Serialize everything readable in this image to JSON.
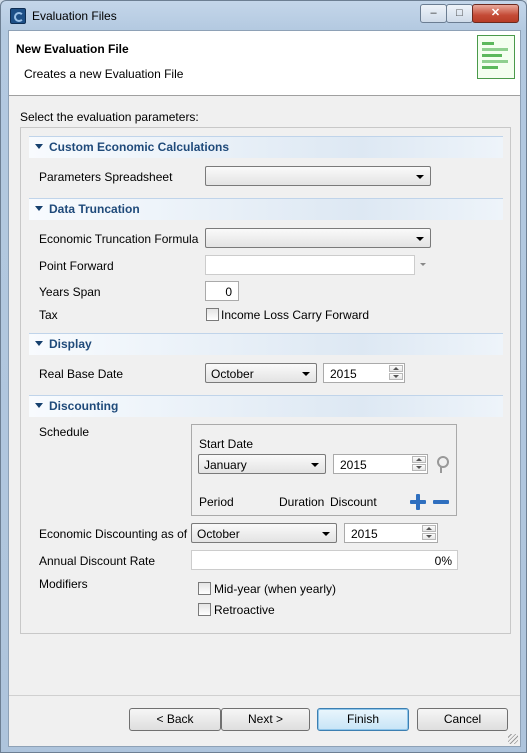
{
  "window": {
    "title": "Evaluation Files",
    "controls": {
      "minimize": "–",
      "maximize": "□",
      "close": "✕"
    }
  },
  "header": {
    "title": "New Evaluation File",
    "description": "Creates a new Evaluation File",
    "icon": "evaluation-file-wizard-icon"
  },
  "prompt": "Select the evaluation parameters:",
  "sections": {
    "custom": {
      "title": "Custom Economic Calculations",
      "parameters_label": "Parameters Spreadsheet",
      "parameters_value": ""
    },
    "truncation": {
      "title": "Data Truncation",
      "formula_label": "Economic Truncation Formula",
      "formula_value": "",
      "point_forward_label": "Point Forward",
      "point_forward_value": "",
      "years_span_label": "Years Span",
      "years_span_value": "0",
      "tax_label": "Tax",
      "tax_checkbox_label": "Income Loss Carry Forward",
      "tax_checked": false
    },
    "display": {
      "title": "Display",
      "real_base_date_label": "Real Base Date",
      "month": "October",
      "year": "2015"
    },
    "discounting": {
      "title": "Discounting",
      "schedule_label": "Schedule",
      "start_date_label": "Start Date",
      "start_month": "January",
      "start_year": "2015",
      "columns": [
        "Period",
        "Duration",
        "Discount"
      ],
      "econ_discounting_label": "Economic Discounting as of",
      "econ_month": "October",
      "econ_year": "2015",
      "annual_rate_label": "Annual Discount Rate",
      "annual_rate_value": "0%",
      "modifiers_label": "Modifiers",
      "midyear_label": "Mid-year (when yearly)",
      "midyear_checked": false,
      "retroactive_label": "Retroactive",
      "retroactive_checked": false
    }
  },
  "buttons": {
    "back": "< Back",
    "next": "Next >",
    "finish": "Finish",
    "cancel": "Cancel"
  },
  "colors": {
    "section_title": "#1f4a7a",
    "plus_minus": "#2f6fbf"
  }
}
